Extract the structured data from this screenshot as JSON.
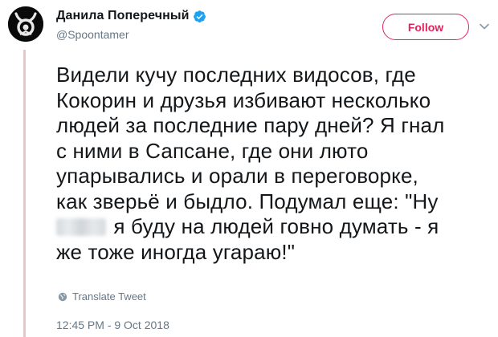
{
  "author": {
    "display_name": "Данила Поперечный",
    "handle": "@Spoontamer",
    "verified": true,
    "verified_color": "#1da1f2"
  },
  "follow_button": {
    "label": "Follow",
    "accent_color": "#e0245e"
  },
  "tweet": {
    "lines": [
      "Видели кучу последних видосов, где",
      "Кокорин и друзья избивают несколько",
      "людей за последние пару дней? Я гнал",
      "с ними в Сапсане, где они люто",
      "упарывались и орали в переговорке,",
      "как зверьё и быдло. Подумал еще: \"Ну",
      "я буду на людей говно думать - я",
      "же тоже иногда угараю!\""
    ],
    "blurred_word_line_index": 6
  },
  "translate": {
    "label": "Translate Tweet",
    "icon": "globe-icon"
  },
  "timestamp": "12:45 PM - 9 Oct 2018",
  "icons": {
    "menu": "chevron-down-icon",
    "verified": "verified-badge-icon",
    "avatar": "avatar"
  }
}
